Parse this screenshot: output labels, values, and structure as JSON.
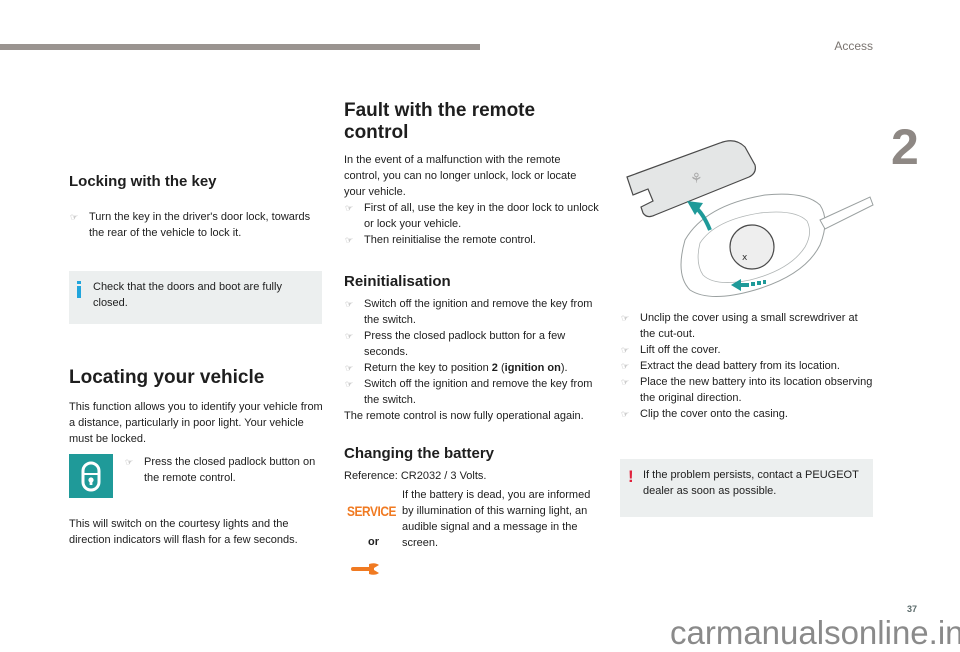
{
  "header": {
    "section_title": "Access",
    "chapter_number": "2"
  },
  "footer": {
    "page_number": "37",
    "watermark": "carmanualsonline.info"
  },
  "bullet_glyph": "☞",
  "locking_with_key": {
    "title": "Locking with the key",
    "steps": [
      "Turn the key in the driver's door lock, towards the rear of the vehicle to lock it."
    ],
    "info_note": "Check that the doors and boot are fully closed."
  },
  "locating_vehicle": {
    "title": "Locating your vehicle",
    "intro": "This function allows you to identify your vehicle from a distance, particularly in poor light. Your vehicle must be locked.",
    "icon": "padlock-closed-icon",
    "steps": [
      "Press the closed padlock button on the remote control."
    ],
    "outcome": "This will switch on the courtesy lights and the direction indicators will flash for a few seconds."
  },
  "fault_remote": {
    "title": "Fault with the remote control",
    "intro": "In the event of a malfunction with the remote control, you can no longer unlock, lock or locate your vehicle.",
    "steps": [
      "First of all, use the key in the door lock to unlock or lock your vehicle.",
      "Then reinitialise the remote control."
    ]
  },
  "reinitialisation": {
    "title": "Reinitialisation",
    "steps": [
      "Switch off the ignition and remove the key from the switch.",
      "Press the closed padlock button for a few seconds."
    ],
    "step3_prefix": "Return the key to position ",
    "step3_bold_number": "2",
    "step3_paren_open": " (",
    "step3_bold_text": "ignition on",
    "step3_suffix": ").",
    "step4": "Switch off the ignition and remove the key from the switch.",
    "outcome": "The remote control is now fully operational again."
  },
  "changing_battery": {
    "title": "Changing the battery",
    "reference": "Reference: CR2032 / 3 Volts.",
    "service_label": "SERVICE",
    "or_label": "or",
    "wrench_icon": "wrench-icon",
    "description": "If the battery is dead, you are informed by illumination of this warning light, an audible signal and a message in the screen.",
    "steps": [
      "Unclip the cover using a small screwdriver at the cut-out.",
      "Lift off the cover.",
      "Extract the dead battery from its location.",
      "Place the new battery into its location observing the original direction.",
      "Clip the cover onto the casing."
    ],
    "warning_note": "If the problem persists, contact a PEUGEOT dealer as soon as possible."
  },
  "colors": {
    "accent_teal": "#1f9a99",
    "service_orange": "#f07a22",
    "info_blue": "#21a5dc",
    "warning_red": "#e0213c",
    "note_bg": "#ecefef"
  }
}
